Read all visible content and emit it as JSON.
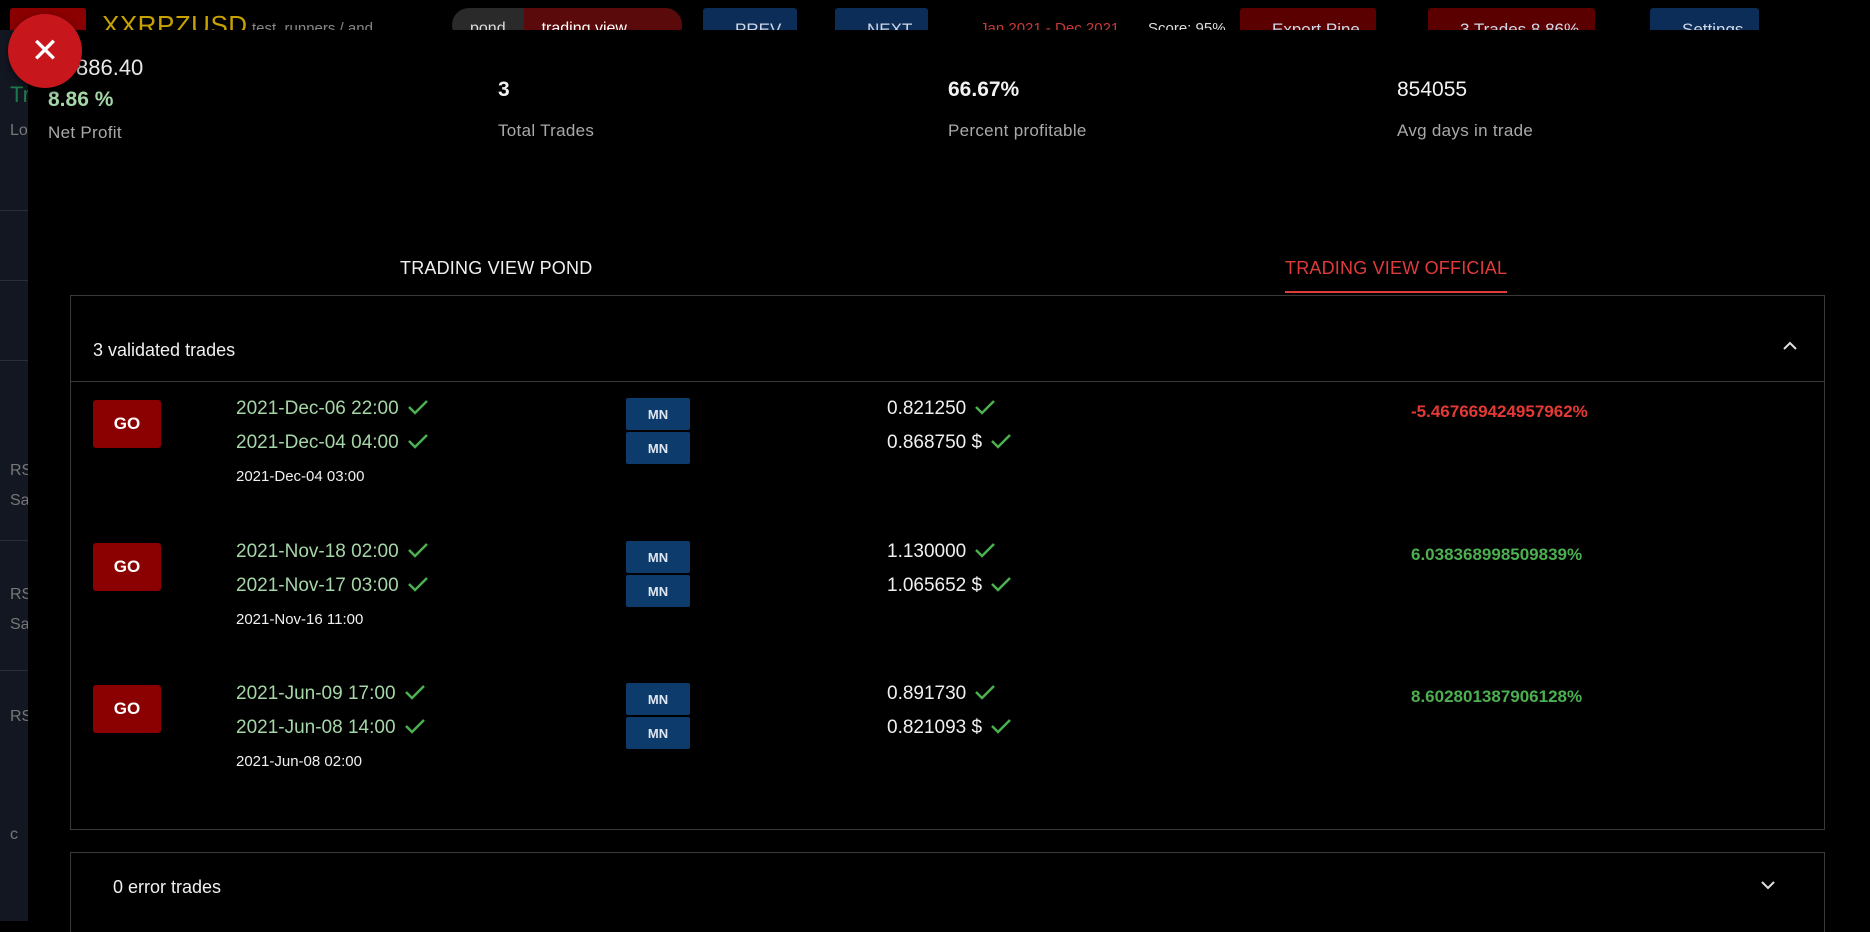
{
  "background": {
    "symbol": "XXRPZUSD",
    "subtitle": "test_runners / and",
    "toggle": [
      "pond",
      "trading view"
    ],
    "prev_label": "PREV",
    "next_label": "NEXT",
    "date_range": "Jan 2021 - Dec 2021",
    "score": "Score: 95%",
    "export_label": "Export Pine",
    "trades_label": "3 Trades",
    "trades_pct": "8.86%",
    "settings_label": "Settings",
    "side_labels": [
      "Tr",
      "Lo",
      "RS",
      "Sa",
      "RS",
      "Sa",
      "RS",
      "c"
    ]
  },
  "stats": {
    "net_amount": "886.40",
    "net_pct": "8.86 %",
    "net_label": "Net Profit",
    "total_trades": "3",
    "total_trades_label": "Total Trades",
    "percent_profitable": "66.67%",
    "percent_profitable_label": "Percent profitable",
    "avg_days": "854055",
    "avg_days_label": "Avg days in trade"
  },
  "tabs": {
    "pond": "TRADING VIEW POND",
    "official": "TRADING VIEW OFFICIAL",
    "active": "official"
  },
  "validated": {
    "title": "3 validated trades",
    "trades": [
      {
        "go": "GO",
        "exit_time": "2021-Dec-06 22:00",
        "entry_time": "2021-Dec-04 04:00",
        "signal_time": "2021-Dec-04 03:00",
        "exit_tag": "MN",
        "entry_tag": "MN",
        "exit_price": "0.821250",
        "entry_price": "0.868750 $",
        "pnl": "-5.467669424957962%",
        "pnl_sign": "neg"
      },
      {
        "go": "GO",
        "exit_time": "2021-Nov-18 02:00",
        "entry_time": "2021-Nov-17 03:00",
        "signal_time": "2021-Nov-16 11:00",
        "exit_tag": "MN",
        "entry_tag": "MN",
        "exit_price": "1.130000",
        "entry_price": "1.065652 $",
        "pnl": "6.038368998509839%",
        "pnl_sign": "pos"
      },
      {
        "go": "GO",
        "exit_time": "2021-Jun-09 17:00",
        "entry_time": "2021-Jun-08 14:00",
        "signal_time": "2021-Jun-08 02:00",
        "exit_tag": "MN",
        "entry_tag": "MN",
        "exit_price": "0.891730",
        "entry_price": "0.821093 $",
        "pnl": "8.602801387906128%",
        "pnl_sign": "pos"
      }
    ]
  },
  "errors": {
    "title": "0 error trades"
  },
  "colors": {
    "accent_red": "#e03b3b",
    "go_red": "#8b0000",
    "tag_blue": "#0d3b6b",
    "check_green": "#4caf50",
    "date_green": "#a5d6a7"
  },
  "icons": {
    "close": "close-icon",
    "check": "check-icon",
    "collapse": "chevron-up-icon",
    "expand": "chevron-down-icon"
  }
}
